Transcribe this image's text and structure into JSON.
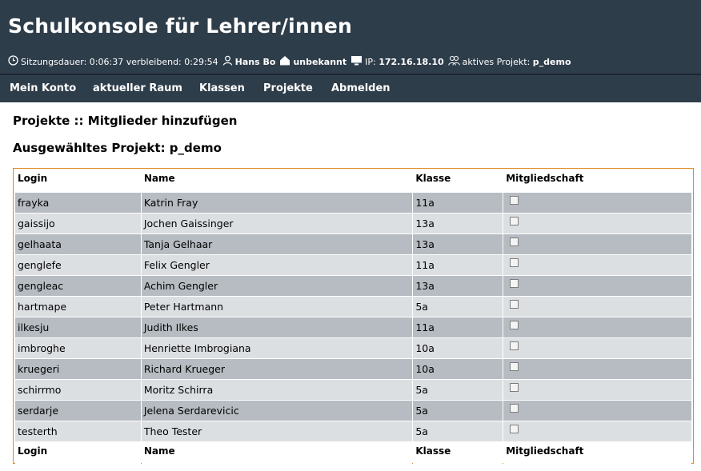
{
  "header": {
    "title": "Schulkonsole für Lehrer/innen",
    "status": {
      "session_label": "Sitzungsdauer:",
      "session_time": "0:06:37",
      "remaining_label": "verbleibend:",
      "remaining_time": "0:29:54",
      "user": "Hans Bo",
      "room": "unbekannt",
      "ip_label": "IP:",
      "ip": "172.16.18.10",
      "project_label": "aktives Projekt:",
      "project": "p_demo"
    }
  },
  "nav": [
    "Mein Konto",
    "aktueller Raum",
    "Klassen",
    "Projekte",
    "Abmelden"
  ],
  "page": {
    "heading": "Projekte :: Mitglieder hinzufügen",
    "subheading": "Ausgewähltes Projekt: p_demo"
  },
  "table": {
    "columns": [
      "Login",
      "Name",
      "Klasse",
      "Mitgliedschaft"
    ],
    "rows": [
      {
        "login": "frayka",
        "name": "Katrin Fray",
        "klasse": "11a",
        "member": false
      },
      {
        "login": "gaissijo",
        "name": "Jochen Gaissinger",
        "klasse": "13a",
        "member": false
      },
      {
        "login": "gelhaata",
        "name": "Tanja Gelhaar",
        "klasse": "13a",
        "member": false
      },
      {
        "login": "genglefe",
        "name": "Felix Gengler",
        "klasse": "11a",
        "member": false
      },
      {
        "login": "gengleac",
        "name": "Achim Gengler",
        "klasse": "13a",
        "member": false
      },
      {
        "login": "hartmape",
        "name": "Peter Hartmann",
        "klasse": "5a",
        "member": false
      },
      {
        "login": "ilkesju",
        "name": "Judith Ilkes",
        "klasse": "11a",
        "member": false
      },
      {
        "login": "imbroghe",
        "name": "Henriette Imbrogiana",
        "klasse": "10a",
        "member": false
      },
      {
        "login": "kruegeri",
        "name": "Richard Krueger",
        "klasse": "10a",
        "member": false
      },
      {
        "login": "schirrmo",
        "name": "Moritz Schirra",
        "klasse": "5a",
        "member": false
      },
      {
        "login": "serdarje",
        "name": "Jelena Serdarevicic",
        "klasse": "5a",
        "member": false
      },
      {
        "login": "testerth",
        "name": "Theo Tester",
        "klasse": "5a",
        "member": false
      }
    ]
  },
  "icons": {
    "session": "clock-icon",
    "user": "user-icon",
    "room": "house-icon",
    "ip": "monitor-icon",
    "project": "group-icon"
  },
  "colors": {
    "header_bg": "#2e3d4a",
    "row_dark": "#b6bcc2",
    "row_light": "#dcdfe2",
    "table_border": "#e08a1e"
  }
}
